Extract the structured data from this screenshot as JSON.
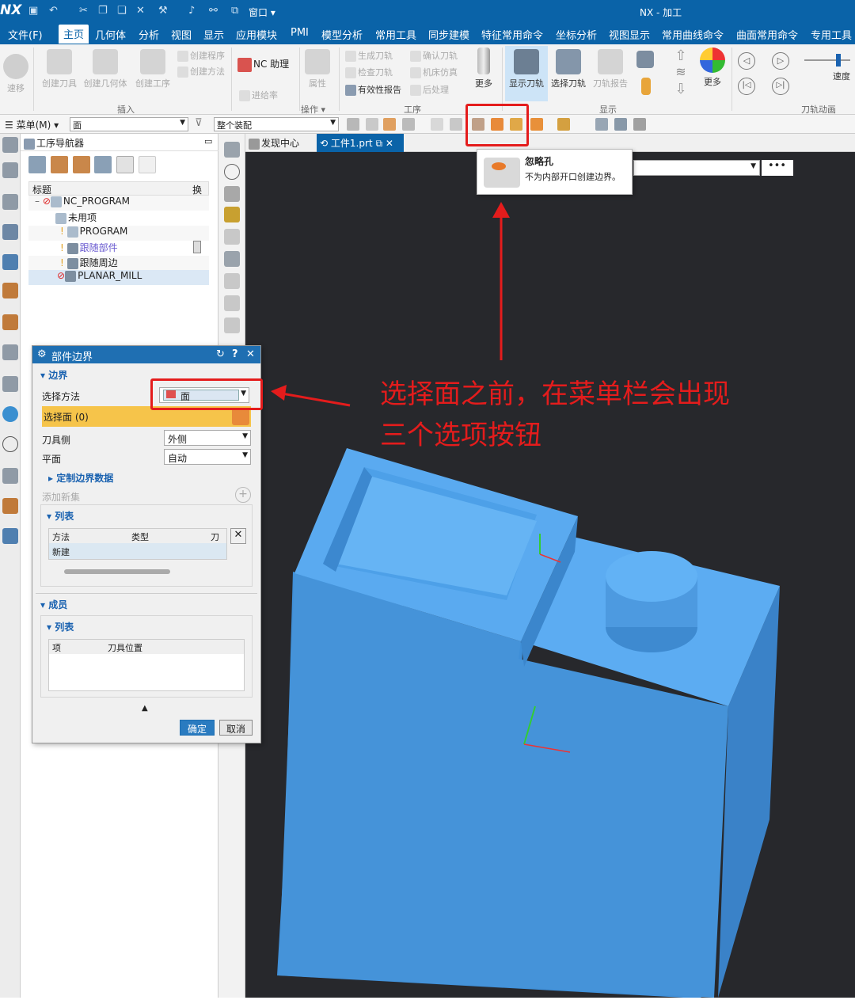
{
  "titlebar": {
    "logo": "NX",
    "window_menu": "窗口",
    "title": "NX - 加工"
  },
  "menubar": {
    "items": [
      "文件(F)",
      "主页",
      "几何体",
      "分析",
      "视图",
      "显示",
      "应用模块",
      "PMI",
      "模型分析",
      "常用工具",
      "同步建模",
      "特征常用命令",
      "坐标分析",
      "视图显示",
      "常用曲线命令",
      "曲面常用命令",
      "专用工具"
    ],
    "active": "主页"
  },
  "ribbon": {
    "buttons": {
      "rebuild": "速移",
      "create_tool": "创建刀具",
      "create_geometry": "创建几何体",
      "create_operation": "创建工序",
      "create_program": "创建程序",
      "create_method": "创建方法",
      "nc_assistant": "NC 助理",
      "properties": "属性",
      "feed_rate": "进给率",
      "generate_path": "生成刀轨",
      "check_path": "检查刀轨",
      "validity_report": "有效性报告",
      "verify_path": "确认刀轨",
      "machine_sim": "机床仿真",
      "postprocess": "后处理",
      "more1": "更多",
      "show_path": "显示刀轨",
      "select_path": "选择刀轨",
      "path_report": "刀轨报告",
      "more2": "更多",
      "speed": "速度"
    },
    "groups": {
      "insert": "插入",
      "operation": "操作",
      "process": "工序",
      "display": "显示",
      "animation": "刀轨动画"
    }
  },
  "selbar": {
    "menu": "菜单(M)",
    "filter_value": "面",
    "scope_value": "整个装配"
  },
  "navigator": {
    "title": "工序导航器",
    "col_title": "标题",
    "col_change": "换刀",
    "tree": [
      "NC_PROGRAM",
      "未用项",
      "PROGRAM",
      "跟随部件",
      "跟随周边",
      "PLANAR_MILL"
    ]
  },
  "tabs": {
    "discovery": "发现中心",
    "part": "工件1.prt"
  },
  "tooltip": {
    "title": "忽略孔",
    "desc": "不为内部开口创建边界。"
  },
  "dialog": {
    "title": "部件边界",
    "sec_boundary": "边界",
    "select_method_label": "选择方法",
    "select_method_value": "面",
    "select_face": "选择面 (0)",
    "tool_side_label": "刀具侧",
    "tool_side_value": "外侧",
    "plane_label": "平面",
    "plane_value": "自动",
    "custom_data": "定制边界数据",
    "add_new_set": "添加新集",
    "sec_list": "列表",
    "col_method": "方法",
    "col_type": "类型",
    "col_tool": "刀具",
    "row_new": "新建",
    "sec_members": "成员",
    "sec_list2": "列表",
    "col_item": "项",
    "col_tool_pos": "刀具位置",
    "ok": "确定",
    "cancel": "取消"
  },
  "annotation": {
    "line1": "选择面之前，在菜单栏会出现",
    "line2": "三个选项按钮"
  },
  "colors": {
    "accent": "#0a63a8",
    "highlight": "#f6c44a",
    "annot": "#e41c1c",
    "part": "#5aaaf0",
    "viewport": "#27282c"
  }
}
